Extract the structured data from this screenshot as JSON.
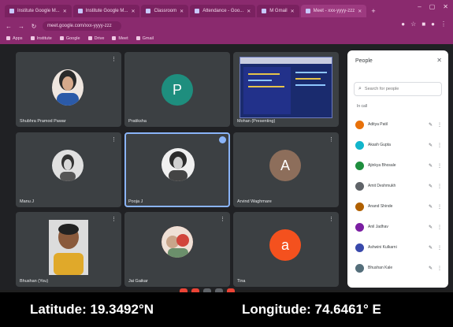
{
  "browser": {
    "tabs": [
      {
        "label": "Institute Google M...",
        "active": false
      },
      {
        "label": "Institute Google M...",
        "active": false
      },
      {
        "label": "Classroom",
        "active": false
      },
      {
        "label": "Attendance - Goo...",
        "active": false
      },
      {
        "label": "M Gmail",
        "active": false
      },
      {
        "label": "Meet - xxx-yyyy-zzz",
        "active": true
      }
    ],
    "url": "meet.google.com/xxx-yyyy-zzz",
    "bookmarks": [
      "Apps",
      "Institute",
      "Google",
      "Drive",
      "Meet",
      "Gmail"
    ]
  },
  "meeting": {
    "tiles": [
      {
        "name": "Shubhra Pramod Pawar",
        "kind": "photo",
        "photo_color": "#2b5aa8"
      },
      {
        "name": "Pratiksha",
        "kind": "letter",
        "letter": "P",
        "color": "#1e8e7e"
      },
      {
        "name": "Mohan (Presenting)",
        "kind": "screen"
      },
      {
        "name": "Manu J",
        "kind": "photo",
        "photo_color": "#9aa0a6"
      },
      {
        "name": "Pooja J",
        "kind": "photo",
        "photo_color": "#bdbdbd",
        "pinned": true
      },
      {
        "name": "Arvind Waghmare",
        "kind": "letter",
        "letter": "A",
        "color": "#8d6e5b"
      },
      {
        "name": "Bhushan (You)",
        "kind": "camera"
      },
      {
        "name": "Jai Gaikar",
        "kind": "photo",
        "photo_color": "#c47a6a"
      },
      {
        "name": "Tina",
        "kind": "letter",
        "letter": "a",
        "color": "#f4511e"
      }
    ]
  },
  "people_panel": {
    "title": "People",
    "search_placeholder": "Search for people",
    "section_label": "In call",
    "participants": [
      {
        "name": "Aditya Patil",
        "color": "#e8710a"
      },
      {
        "name": "Akash Gupta",
        "color": "#12b5cb"
      },
      {
        "name": "Ajinkya Bhosale",
        "color": "#1e8e3e"
      },
      {
        "name": "Amit Deshmukh",
        "color": "#5f6368"
      },
      {
        "name": "Anand Shinde",
        "color": "#b06000"
      },
      {
        "name": "Anil Jadhav",
        "color": "#7b1fa2"
      },
      {
        "name": "Ashwini Kulkarni",
        "color": "#3949ab"
      },
      {
        "name": "Bhushan Kale",
        "color": "#546e7a"
      }
    ]
  },
  "caption": {
    "latitude": "Latitude: 19.3492°N",
    "longitude": "Longitude: 74.6461° E"
  }
}
